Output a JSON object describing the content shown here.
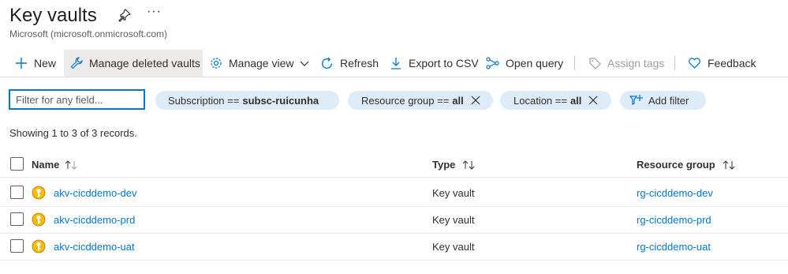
{
  "header": {
    "title": "Key vaults",
    "subtitle": "Microsoft (microsoft.onmicrosoft.com)",
    "more_label": "···"
  },
  "toolbar": {
    "new": "New",
    "manage_deleted": "Manage deleted vaults",
    "manage_view": "Manage view",
    "refresh": "Refresh",
    "export_csv": "Export to CSV",
    "open_query": "Open query",
    "assign_tags": "Assign tags",
    "feedback": "Feedback"
  },
  "filters": {
    "placeholder": "Filter for any field...",
    "subscription_label": "Subscription ==",
    "subscription_value": "subsc-ruicunha",
    "resource_group_label": "Resource group ==",
    "resource_group_value": "all",
    "location_label": "Location ==",
    "location_value": "all",
    "add_filter": "Add filter"
  },
  "records_text": "Showing 1 to 3 of 3 records.",
  "table": {
    "columns": {
      "name": "Name",
      "type": "Type",
      "resource_group": "Resource group"
    },
    "rows": [
      {
        "name": "akv-cicddemo-dev",
        "type": "Key vault",
        "resource_group": "rg-cicddemo-dev"
      },
      {
        "name": "akv-cicddemo-prd",
        "type": "Key vault",
        "resource_group": "rg-cicddemo-prd"
      },
      {
        "name": "akv-cicddemo-uat",
        "type": "Key vault",
        "resource_group": "rg-cicddemo-uat"
      }
    ]
  },
  "colors": {
    "accent": "#0078d4",
    "pill_bg": "#deecf9",
    "keyvault_icon": "#ffb900"
  },
  "icons": [
    "pin-icon",
    "plus-icon",
    "wrench-icon",
    "gear-icon",
    "chevron-down-icon",
    "refresh-icon",
    "download-icon",
    "query-icon",
    "tag-icon",
    "heart-icon",
    "close-icon",
    "add-filter-icon",
    "key-vault-icon",
    "sort-icon"
  ]
}
